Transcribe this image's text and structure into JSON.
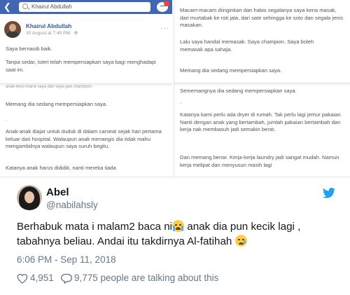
{
  "colors": {
    "facebook_blue": "#4267b2",
    "twitter_blue": "#1da1f2",
    "text_primary": "#14171a",
    "text_secondary": "#657786"
  },
  "screenshot": {
    "search_query": "Khairul Abdullah",
    "icons": [
      "back-arrow-icon",
      "search-icon",
      "messenger-icon"
    ],
    "post": {
      "author": "Khairul Abdullah",
      "meta": "30 August at 7:40 PM · ",
      "globe_icon": "globe-icon",
      "more_icon": "more-options-icon",
      "text1": "Saya bernasib baik.",
      "text2": "Tanpa sedar, isteri telah mempersiapkan saya bagi menghadapi saat ini.",
      "cut_line": "anak-kecil mana saya dari saya jadi champion.",
      "text3": "Memang dia sedang mempersiapkan saya.",
      "text4": "Anak-anak diajar untuk duduk di dalam carseat sejak hari pertama keluar dari hospital. Walaupun anak menangis dia tidak mahu mengambilnya walaupun saya suruh begitu.",
      "text5": "Katanya anak harus dididik, nanti mereka tiada"
    },
    "right": {
      "text1": "Macam-macam diinginkan dan habis segalanya saya kena masak, dari murtabak ke roti jala, dari sate sehingga ke soto dan segala jenis masakan.",
      "text2": "Lalu saya handal memasak. Saya champion. Saya boleh memasak apa sahaja.",
      "text3": "Memang dia sedang mempersiapkan saya.",
      "text4": "Sememangnya dia sedang mempersiapkan saya.",
      "text5": "Katanya kami perlu ada dryer di rumah. Tak perlu lagi jemur pakaian. Nanti dengan anak yang bertambah, jumlah pakaian bertambah dan kerja nak membasuh jadi semakin berat.",
      "text6": "Dan memang benar. Kerja-kerja laundry jadi sangat mudah. Namun kerja melipat dan menyusun masih lagi"
    }
  },
  "tweet": {
    "display_name": "Abel",
    "handle": "@nabilahsly",
    "text_line1_a": "Berhabuk mata i malam2 baca ni",
    "text_line1_b": " anak dia pun kecik lagi ,",
    "text_line2_a": "tabahnya beliau. Andai itu takdirnya Al-fatihah ",
    "emoji1": "loudly-crying-face",
    "emoji2": "crying-face",
    "timestamp": "6:06 PM - Sep 11, 2018",
    "likes": "4,951",
    "talking": "9,775 people are talking about this",
    "icons": [
      "twitter-bird-icon",
      "heart-icon",
      "reply-bubble-icon"
    ]
  }
}
